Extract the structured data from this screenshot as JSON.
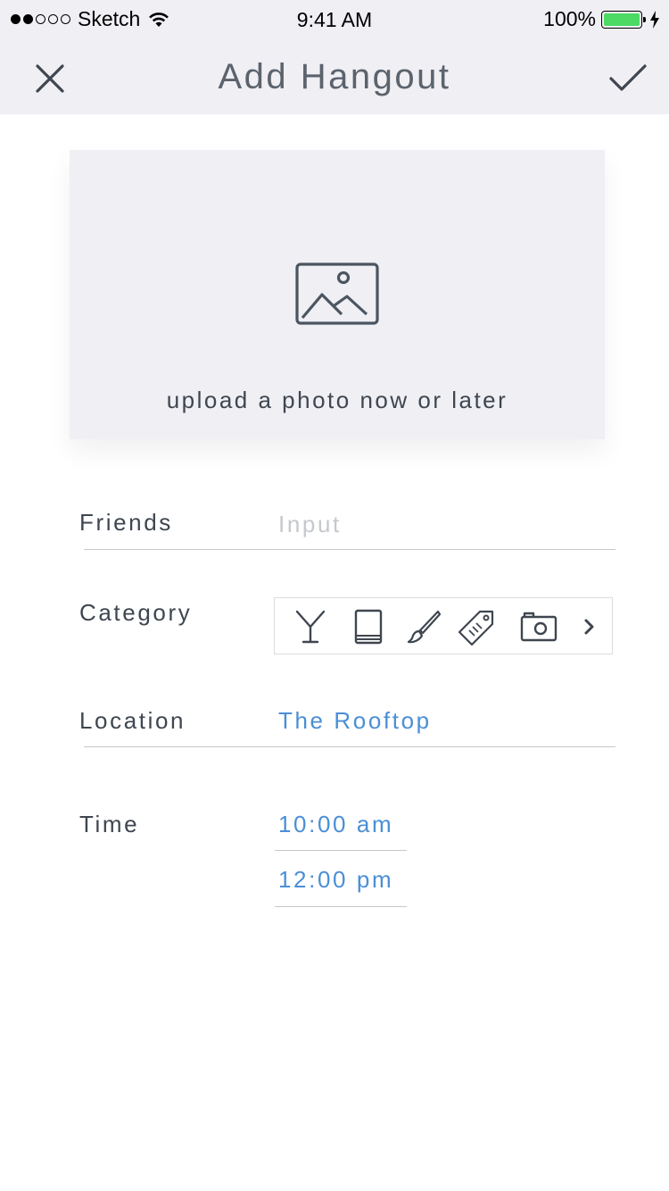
{
  "status_bar": {
    "carrier": "Sketch",
    "time": "9:41 AM",
    "battery": "100%"
  },
  "nav": {
    "title": "Add Hangout",
    "close_icon": "close-icon",
    "done_icon": "checkmark-icon"
  },
  "photo": {
    "icon": "image-icon",
    "text": "upload a photo now or later"
  },
  "form": {
    "friends": {
      "label": "Friends",
      "placeholder": "Input",
      "value": ""
    },
    "category": {
      "label": "Category",
      "icons": [
        "cocktail-icon",
        "book-icon",
        "paintbrush-icon",
        "tag-icon",
        "camera-icon",
        "chevron-right-icon"
      ]
    },
    "location": {
      "label": "Location",
      "value": "The Rooftop"
    },
    "time": {
      "label": "Time",
      "start": "10:00 am",
      "end": "12:00 pm"
    }
  },
  "colors": {
    "accent": "#4a8fd6",
    "bar_background": "#efeff4",
    "text": "#3f4650",
    "placeholder": "#c5c8cc",
    "battery": "#4cd964"
  }
}
